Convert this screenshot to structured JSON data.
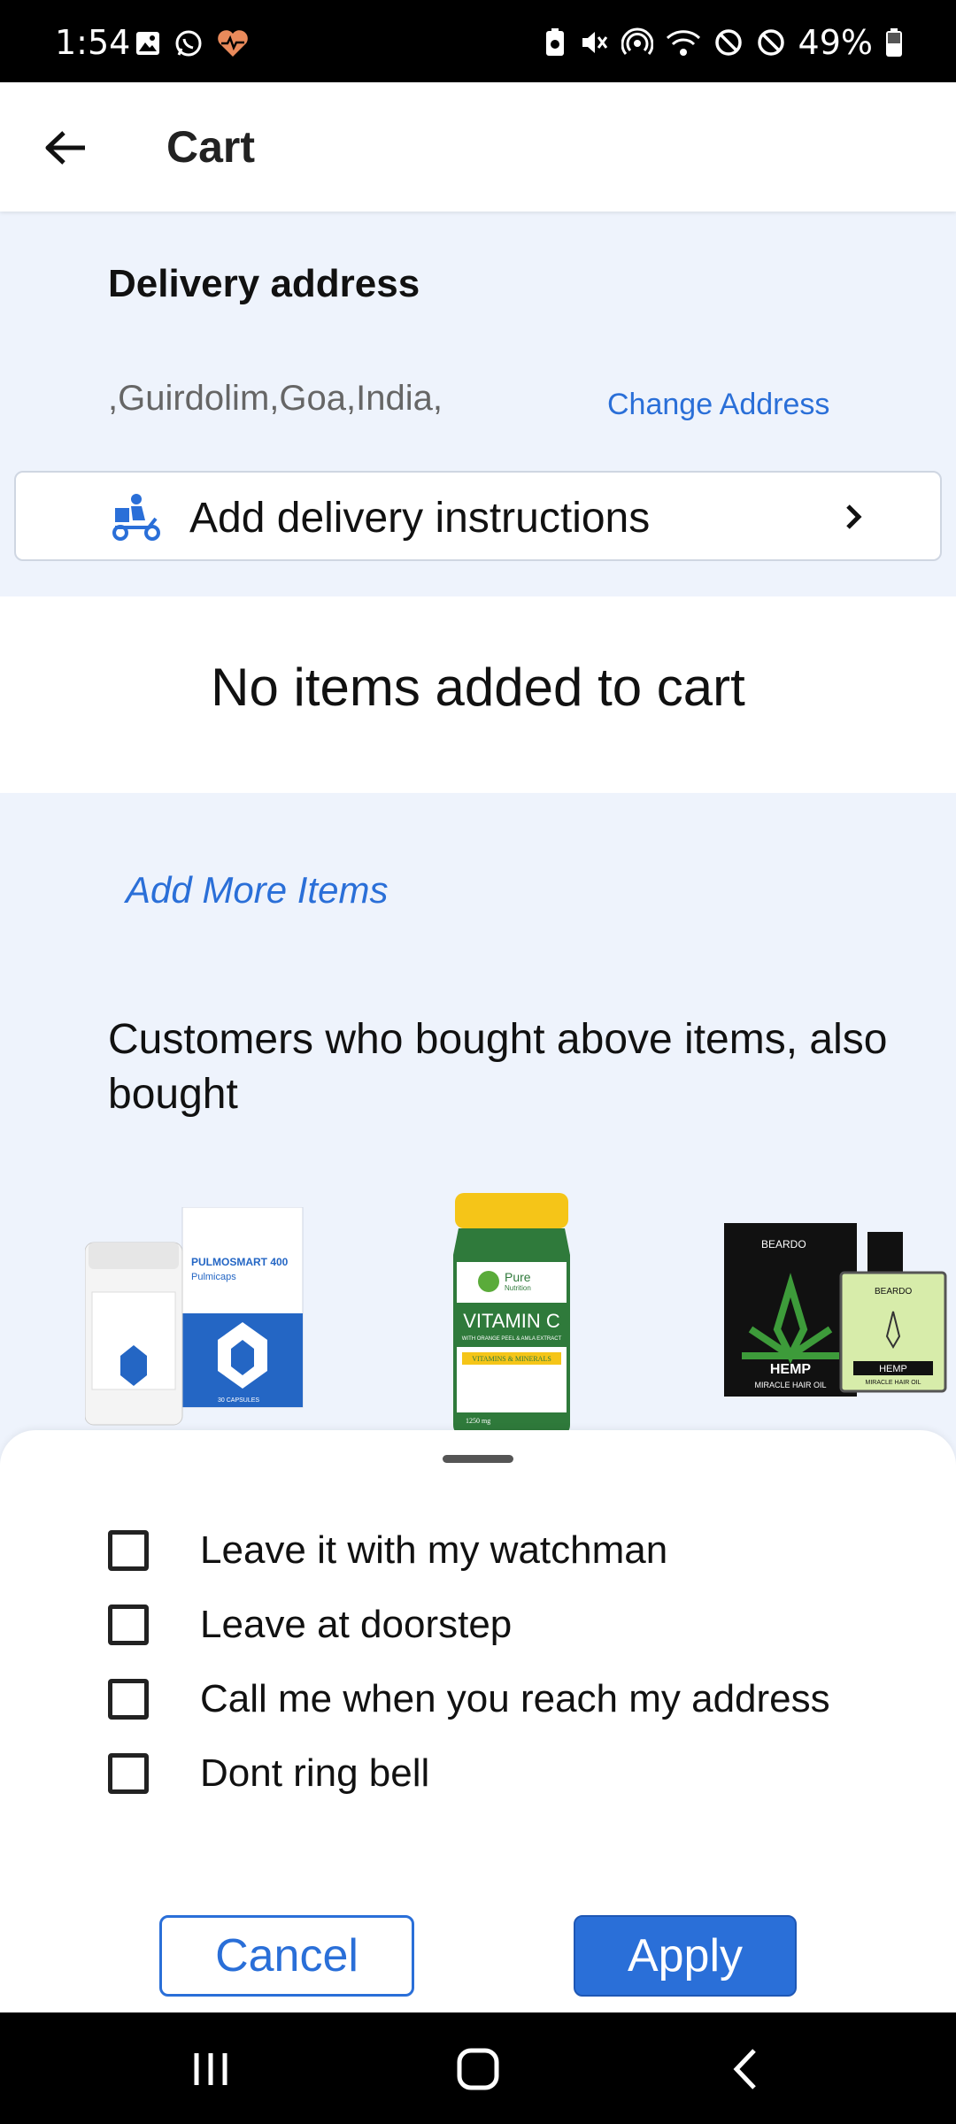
{
  "status_bar": {
    "time": "1:54",
    "battery": "49%"
  },
  "app_bar": {
    "title": "Cart"
  },
  "address": {
    "heading": "Delivery address",
    "value": ",Guirdolim,Goa,India,",
    "change_label": "Change Address"
  },
  "instructions": {
    "label": "Add delivery instructions"
  },
  "cart": {
    "empty_message": "No items added to cart",
    "add_more_label": "Add More Items"
  },
  "recommendations": {
    "heading": "Customers who bought above items, also bought",
    "products": [
      {
        "box_text": "PULMOSMART 400",
        "box_sub": "Pulmicaps",
        "box_count": "30 CAPSULES"
      },
      {
        "brand": "Pure",
        "brand_sub": "Nutrition",
        "name": "VITAMIN C",
        "desc": "WITH ORANGE PEEL & AMLA EXTRACT",
        "band": "VITAMINS & MINERALS",
        "weight": "1250 mg"
      },
      {
        "brand": "BEARDO",
        "name": "HEMP",
        "desc": "MIRACLE HAIR OIL"
      }
    ]
  },
  "sheet": {
    "options": [
      {
        "label": "Leave it with my watchman",
        "checked": false
      },
      {
        "label": "Leave at doorstep",
        "checked": false
      },
      {
        "label": "Call me when you reach my address",
        "checked": false
      },
      {
        "label": "Dont ring bell",
        "checked": false
      }
    ],
    "cancel_label": "Cancel",
    "apply_label": "Apply"
  },
  "colors": {
    "accent": "#2a6fd8",
    "background": "#eef3fc"
  }
}
